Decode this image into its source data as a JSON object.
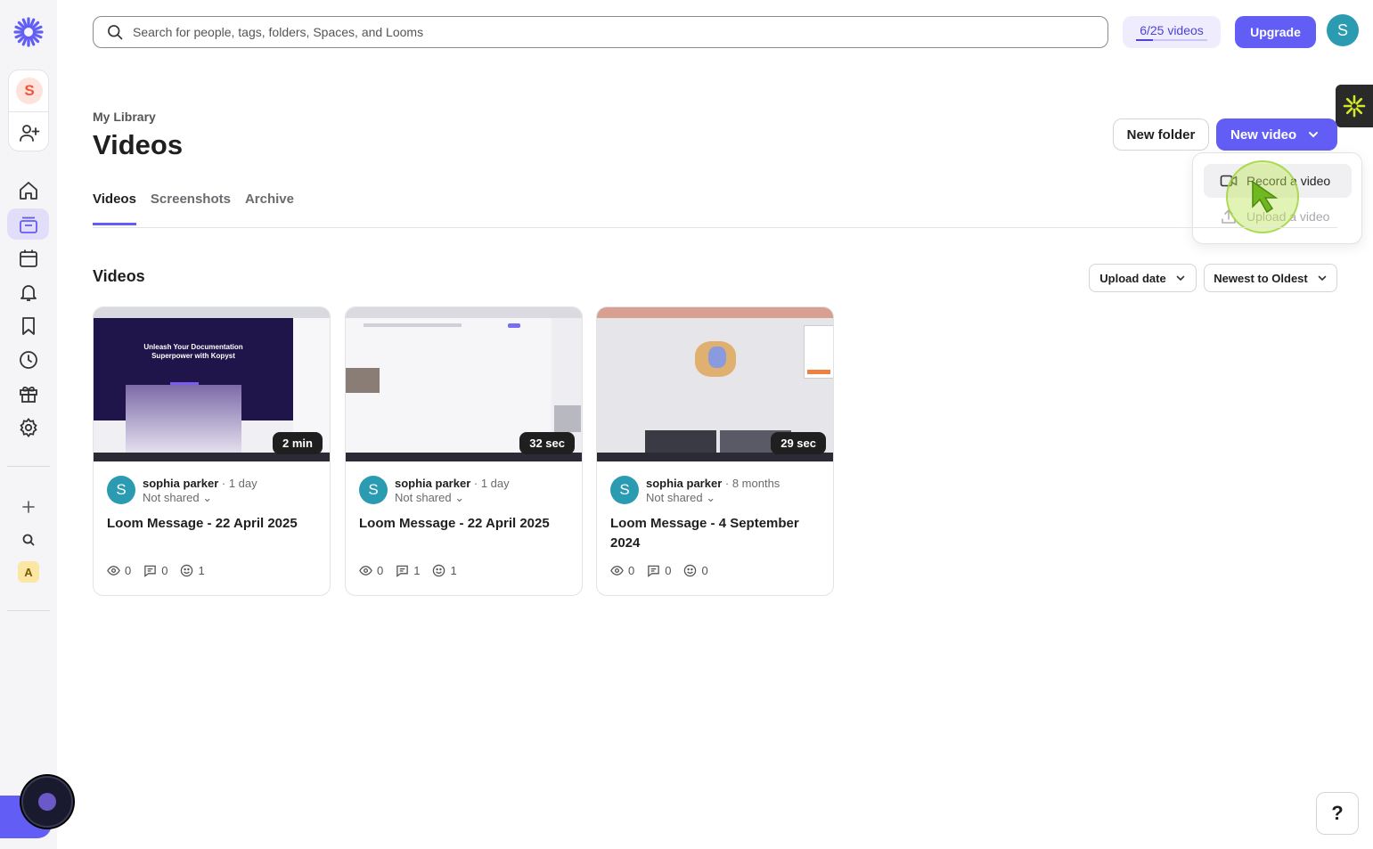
{
  "search": {
    "placeholder": "Search for people, tags, folders, Spaces, and Looms"
  },
  "quota": {
    "label": "6/25 videos",
    "fraction": 0.24
  },
  "header": {
    "upgrade_label": "Upgrade",
    "user_initial": "S"
  },
  "sidebar": {
    "workspace_initial": "S",
    "items": [
      "home-icon",
      "library-icon",
      "calendar-icon",
      "bell-icon",
      "bookmark-icon",
      "history-icon",
      "gift-icon",
      "settings-icon"
    ],
    "badge_letter": "A"
  },
  "page": {
    "breadcrumb": "My Library",
    "title": "Videos",
    "new_folder_label": "New folder",
    "new_video_label": "New video"
  },
  "dropdown": {
    "record_label": "Record a video",
    "upload_label": "Upload a video"
  },
  "tabs": [
    {
      "label": "Videos",
      "active": true
    },
    {
      "label": "Screenshots",
      "active": false
    },
    {
      "label": "Archive",
      "active": false
    }
  ],
  "section": {
    "title": "Videos",
    "sort_field": "Upload date",
    "sort_order": "Newest to Oldest"
  },
  "videos": [
    {
      "owner": "sophia parker",
      "age": "· 1 day",
      "sharing": "Not shared",
      "title": "Loom Message - 22 April 2025",
      "duration": "2 min",
      "views": "0",
      "comments": "0",
      "reactions": "1",
      "avatar": "S"
    },
    {
      "owner": "sophia parker",
      "age": "· 1 day",
      "sharing": "Not shared",
      "title": "Loom Message - 22 April 2025",
      "duration": "32 sec",
      "views": "0",
      "comments": "1",
      "reactions": "1",
      "avatar": "S"
    },
    {
      "owner": "sophia parker",
      "age": "· 8 months",
      "sharing": "Not shared",
      "title": "Loom Message - 4 September 2024",
      "duration": "29 sec",
      "views": "0",
      "comments": "0",
      "reactions": "0",
      "avatar": "S"
    }
  ],
  "thumbnail_texts": {
    "first_line1": "Unleash Your Documentation",
    "first_line2": "Superpower with Kopyst"
  },
  "help_label": "?",
  "colors": {
    "accent": "#625df5",
    "avatar": "#2a9bb0"
  }
}
